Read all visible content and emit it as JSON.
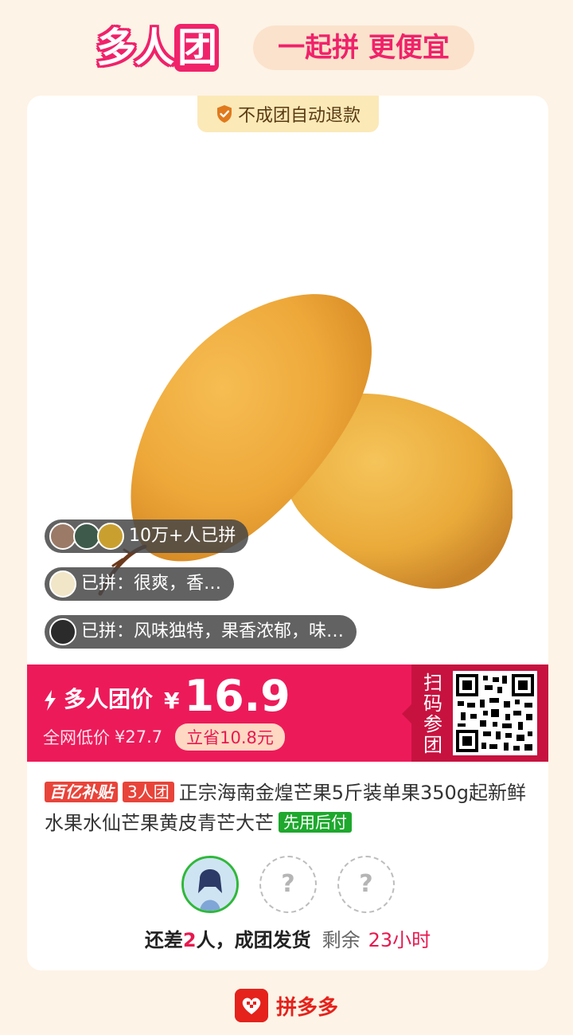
{
  "header": {
    "brand_main": "多人",
    "brand_last": "团",
    "tagline": "一起拼 更便宜"
  },
  "card": {
    "refund_badge": "不成团自动退款",
    "social": {
      "joined_count": "10万+人已拼",
      "review_1": "已拼：很爽，香…",
      "review_2": "已拼：风味独特，果香浓郁，味…"
    },
    "price": {
      "label": "多人团价",
      "currency": "¥",
      "value": "16.9",
      "compare_label": "全网低价",
      "compare_price": "¥27.7",
      "save": "立省10.8元",
      "scan_label": "扫码参团"
    },
    "product": {
      "tag_subsidy": "百亿补贴",
      "tag_group": "3人团",
      "title": "正宗海南金煌芒果5斤装单果350g起新鲜水果水仙芒果黄皮青芒大芒",
      "tag_paylater": "先用后付"
    },
    "group": {
      "empty_slot_1": "?",
      "empty_slot_2": "?",
      "status_prefix": "还差",
      "status_count": "2",
      "status_suffix": "人，成团发货",
      "remain_label": "剩余",
      "remain_time": "23小时"
    }
  },
  "footer": {
    "brand": "拼多多"
  },
  "colors": {
    "accent": "#ed1a5a",
    "scan_panel": "#c7123f",
    "background": "#fdf3e6",
    "paylater_green": "#1ea82d"
  }
}
